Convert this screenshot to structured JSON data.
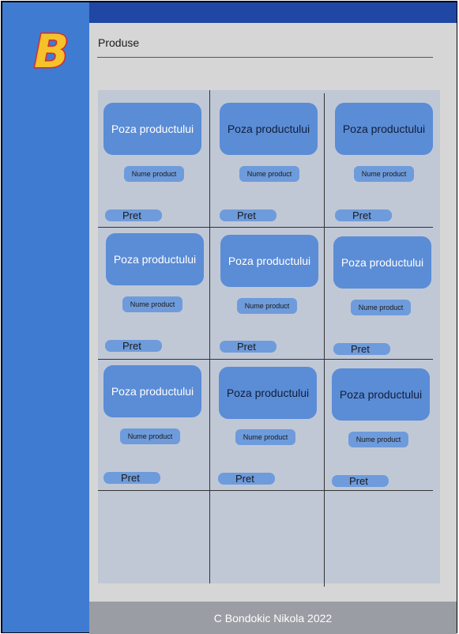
{
  "header": {
    "title": "Produse"
  },
  "logo": {
    "letter": "B",
    "colors": {
      "fill": "#f5c22b",
      "outline": "#d92b2b"
    }
  },
  "products": [
    {
      "photo": "Poza productului",
      "name": "Nume product",
      "price": "Pret"
    },
    {
      "photo": "Poza productului",
      "name": "Nume product",
      "price": "Pret"
    },
    {
      "photo": "Poza productului",
      "name": "Nume product",
      "price": "Pret"
    },
    {
      "photo": "Poza productului",
      "name": "Nume product",
      "price": "Pret"
    },
    {
      "photo": "Poza productului",
      "name": "Nume product",
      "price": "Pret"
    },
    {
      "photo": "Poza productului",
      "name": "Nume product",
      "price": "Pret"
    },
    {
      "photo": "Poza productului",
      "name": "Nume product",
      "price": "Pret"
    },
    {
      "photo": "Poza productului",
      "name": "Nume product",
      "price": "Pret"
    },
    {
      "photo": "Poza productului",
      "name": "Nume product",
      "price": "Pret"
    }
  ],
  "footer": {
    "text": "C Bondokic Nikola 2022"
  },
  "colors": {
    "sidebar": "#3f7bd0",
    "topbar": "#1f47a3",
    "card": "#5b8cd6",
    "panel": "#c0c8d6",
    "footer": "#9a9da3"
  }
}
